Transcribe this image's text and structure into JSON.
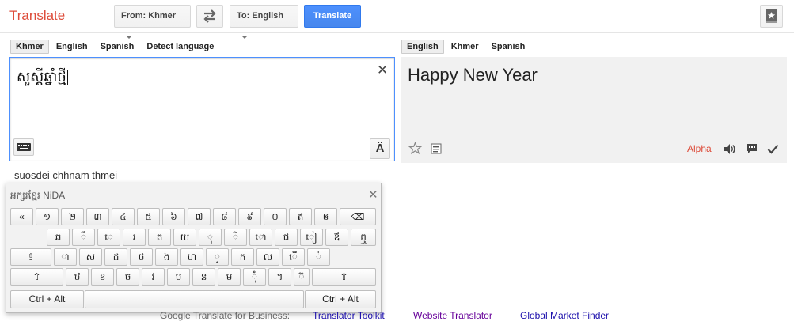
{
  "header": {
    "brand": "Translate",
    "from_label": "From: Khmer",
    "to_label": "To: English",
    "translate_label": "Translate"
  },
  "source": {
    "tabs": [
      {
        "label": "Khmer",
        "active": true
      },
      {
        "label": "English",
        "active": false
      },
      {
        "label": "Spanish",
        "active": false
      },
      {
        "label": "Detect language",
        "active": false
      }
    ],
    "text": "សួស្តីឆ្នាំថ្មី",
    "close_glyph": "✕",
    "ae_label": "Ä",
    "transliteration": "suosdei chhnam thmei"
  },
  "result": {
    "tabs": [
      {
        "label": "English",
        "active": true
      },
      {
        "label": "Khmer",
        "active": false
      },
      {
        "label": "Spanish",
        "active": false
      }
    ],
    "text": "Happy New Year",
    "alpha_label": "Alpha"
  },
  "keyboard": {
    "title": "អក្សរខ្មែរ NiDA",
    "close_glyph": "✕",
    "row1": [
      "«",
      "១",
      "២",
      "៣",
      "៤",
      "៥",
      "៦",
      "៧",
      "៨",
      "៩",
      "០",
      "ឥ",
      "ឲ",
      "⌫"
    ],
    "row2": [
      "ឆ",
      "ឹ",
      "េ",
      "រ",
      "ត",
      "យ",
      "ុ",
      "ិ",
      "ោ",
      "ផ",
      "ៀ",
      "ឪ",
      "ឮ"
    ],
    "row3": [
      "⇪",
      "ា",
      "ស",
      "ដ",
      "ថ",
      "ង",
      "ហ",
      "្",
      "ក",
      "ល",
      "ើ",
      "់"
    ],
    "row4": [
      "⇧",
      "ឋ",
      "ខ",
      "ច",
      "វ",
      "ប",
      "ន",
      "ម",
      "ុំ",
      "។",
      "៊",
      "⇧"
    ],
    "row5": [
      "Ctrl + Alt",
      "",
      "Ctrl + Alt"
    ]
  },
  "footer": {
    "label": "Google Translate for Business:",
    "links": [
      "Translator Toolkit",
      "Website Translator",
      "Global Market Finder"
    ]
  },
  "colors": {
    "brand": "#dd4b39",
    "primary_button": "#4d90fe",
    "link": "#1a0dab",
    "visited_link": "#660099"
  }
}
